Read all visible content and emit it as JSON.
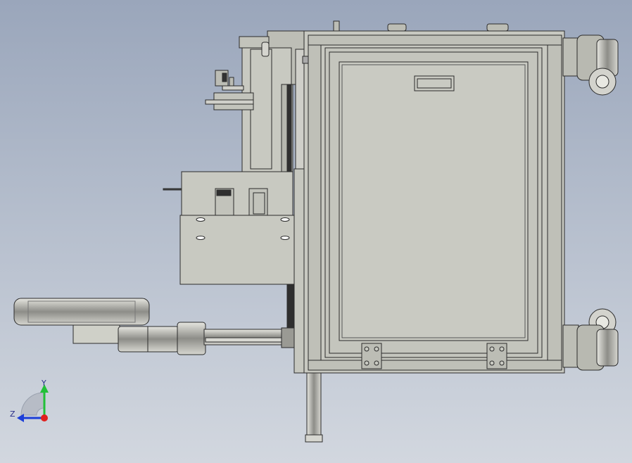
{
  "viewport": {
    "background_top": "#9aa6bb",
    "background_bottom": "#d2d7df",
    "model_fill": "#c8c9c1",
    "model_stroke": "#2b2b2b",
    "shade_fill": "#a9aaa3"
  },
  "triad": {
    "y_label": "Y",
    "z_label": "Z",
    "y_color": "#22c038",
    "z_color": "#1c3ed8",
    "origin_color": "#e0201e"
  }
}
